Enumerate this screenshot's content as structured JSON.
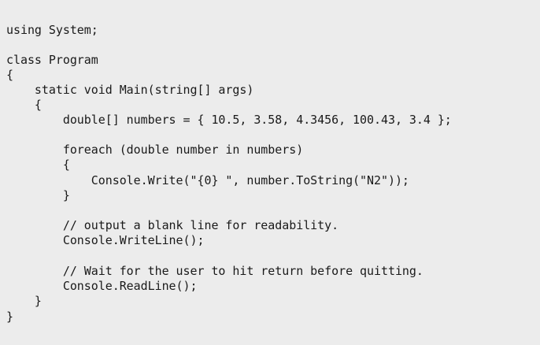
{
  "code": {
    "lines": [
      "using System;",
      "",
      "class Program",
      "{",
      "    static void Main(string[] args)",
      "    {",
      "        double[] numbers = { 10.5, 3.58, 4.3456, 100.43, 3.4 };",
      "",
      "        foreach (double number in numbers)",
      "        {",
      "            Console.Write(\"{0} \", number.ToString(\"N2\"));",
      "        }",
      "",
      "        // output a blank line for readability.",
      "        Console.WriteLine();",
      "",
      "        // Wait for the user to hit return before quitting.",
      "        Console.ReadLine();",
      "    }",
      "}"
    ]
  }
}
